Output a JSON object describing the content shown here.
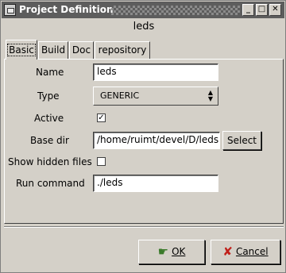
{
  "window": {
    "title": "Project Definition",
    "project_name": "leds",
    "controls": {
      "minimize": "_",
      "maximize": "□",
      "close": "✕"
    }
  },
  "tabs": [
    {
      "label": "Basic",
      "active": true
    },
    {
      "label": "Build",
      "active": false
    },
    {
      "label": "Doc",
      "active": false
    },
    {
      "label": "repository",
      "active": false
    }
  ],
  "form": {
    "name_label": "Name",
    "name_value": "leds",
    "type_label": "Type",
    "type_value": "GENERIC",
    "active_label": "Active",
    "active_mark": "✓",
    "base_dir_label": "Base dir",
    "base_dir_value": "/home/ruimt/devel/D/leds",
    "select_label": "Select",
    "show_hidden_label": "Show hidden files",
    "run_command_label": "Run command",
    "run_command_value": "./leds"
  },
  "buttons": {
    "ok_label": "OK",
    "cancel_label": "Cancel"
  },
  "icons": {
    "ok": "ok-hand-icon",
    "cancel": "cancel-x-icon",
    "combo_arrows": "updown-arrows-icon"
  }
}
